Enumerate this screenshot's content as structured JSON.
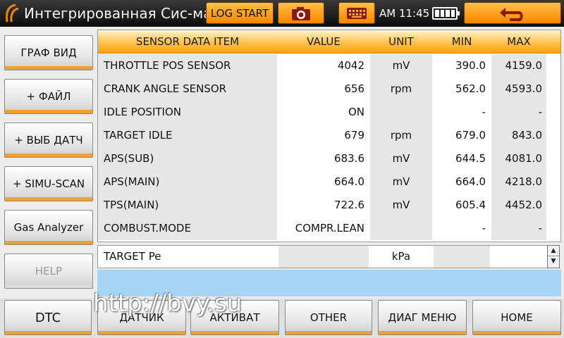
{
  "header": {
    "title": "Интегрированная Сис-ма Ди",
    "log_start_label": "LOG START",
    "time": "AM 11:45",
    "camera_icon": "camera-icon",
    "keyboard_icon": "keyboard-icon",
    "back_icon": "back-arrow-icon",
    "battery_level": 1.0
  },
  "sidebar": {
    "items": [
      {
        "label": "ГРАФ ВИД",
        "enabled": true
      },
      {
        "label": "+ ФАЙЛ",
        "enabled": true
      },
      {
        "label": "+ ВЫБ ДАТЧ",
        "enabled": true
      },
      {
        "label": "+ SIMU-SCAN",
        "enabled": true
      },
      {
        "label": "Gas Analyzer",
        "enabled": true
      },
      {
        "label": "HELP",
        "enabled": false
      }
    ]
  },
  "table": {
    "headers": {
      "item": "SENSOR DATA ITEM",
      "value": "VALUE",
      "unit": "UNIT",
      "min": "MIN",
      "max": "MAX"
    },
    "rows": [
      {
        "item": "THROTTLE POS SENSOR",
        "value": "4042",
        "unit": "mV",
        "min": "390.0",
        "max": "4159.0"
      },
      {
        "item": "CRANK ANGLE SENSOR",
        "value": "656",
        "unit": "rpm",
        "min": "562.0",
        "max": "4593.0"
      },
      {
        "item": "IDLE POSITION",
        "value": "ON",
        "unit": "",
        "min": "-",
        "max": "-"
      },
      {
        "item": "TARGET IDLE",
        "value": "679",
        "unit": "rpm",
        "min": "679.0",
        "max": "843.0"
      },
      {
        "item": "APS(SUB)",
        "value": "683.6",
        "unit": "mV",
        "min": "644.5",
        "max": "4081.0"
      },
      {
        "item": "APS(MAIN)",
        "value": "664.0",
        "unit": "mV",
        "min": "664.0",
        "max": "4218.0"
      },
      {
        "item": "TPS(MAIN)",
        "value": "722.6",
        "unit": "mV",
        "min": "605.4",
        "max": "4452.0"
      },
      {
        "item": "COMBUST.MODE",
        "value": "COMPR.LEAN",
        "unit": "",
        "min": "-",
        "max": "-"
      }
    ],
    "extra_row": {
      "item": "TARGET Pe",
      "value": "",
      "unit": "kPa",
      "min": "",
      "max": ""
    }
  },
  "bottom": {
    "dtc": "DTC",
    "sensor": "ДАТЧИК",
    "activ": "АКТИВАТ",
    "other": "OTHER",
    "diag": "ДИАГ МЕНЮ",
    "home": "HOME"
  },
  "watermark": "http://bvy.su",
  "colors": {
    "accent": "#ff9d1a",
    "info_bar": "#a6d4f5"
  }
}
